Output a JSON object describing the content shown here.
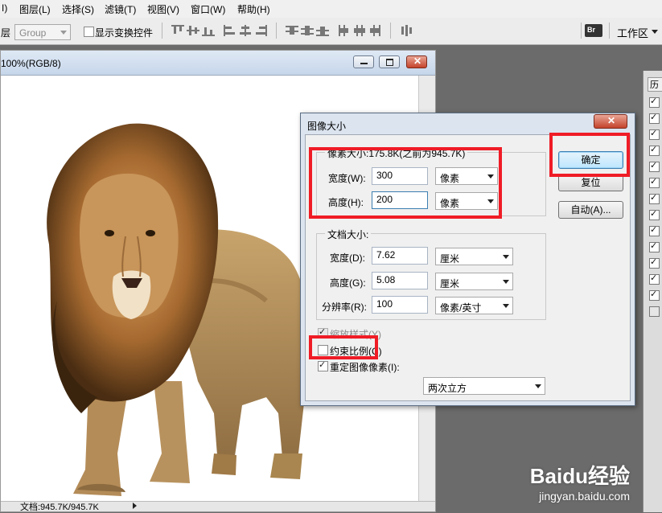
{
  "menubar": {
    "items": [
      "I)",
      "图层(L)",
      "选择(S)",
      "滤镜(T)",
      "视图(V)",
      "窗口(W)",
      "帮助(H)"
    ]
  },
  "options_bar": {
    "layer_label": "层",
    "layer_select_value": "Group",
    "show_transform_label": "显示变换控件",
    "workspace_label": "工作区"
  },
  "document": {
    "title": "100%(RGB/8)",
    "status": "文档:945.7K/945.7K"
  },
  "dialog": {
    "title": "图像大小",
    "pixel_group_label": "像素大小:175.8K(之前为945.7K)",
    "width_label": "宽度(W):",
    "width_value": "300",
    "width_unit": "像素",
    "height_label": "高度(H):",
    "height_value": "200",
    "height_unit": "像素",
    "doc_group_label": "文档大小:",
    "doc_width_label": "宽度(D):",
    "doc_width_value": "7.62",
    "doc_width_unit": "厘米",
    "doc_height_label": "高度(G):",
    "doc_height_value": "5.08",
    "doc_height_unit": "厘米",
    "resolution_label": "分辨率(R):",
    "resolution_value": "100",
    "resolution_unit": "像素/英寸",
    "scale_styles_label": "缩放样式(Y)",
    "constrain_label": "约束比例(C)",
    "resample_label": "重定图像像素(I):",
    "resample_method": "两次立方",
    "ok_label": "确定",
    "reset_label": "复位",
    "auto_label": "自动(A)..."
  },
  "right_panel": {
    "tab_label": "历"
  },
  "watermark": {
    "brand": "Baidu经验",
    "url": "jingyan.baidu.com"
  },
  "colors": {
    "highlight_red": "#ef1c26",
    "default_button": "#bee6fd",
    "workspace_bg": "#6b6b6b"
  }
}
